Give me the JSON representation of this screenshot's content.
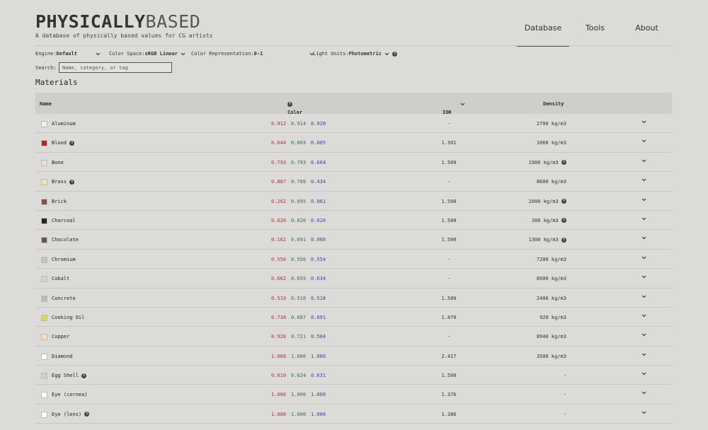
{
  "header": {
    "logo_bold": "PHYSICALLY",
    "logo_light": "BASED",
    "tagline": "A database of physically based values for CG artists"
  },
  "nav": [
    {
      "label": "Database",
      "active": true
    },
    {
      "label": "Tools",
      "active": false
    },
    {
      "label": "About",
      "active": false
    }
  ],
  "controls": {
    "engine_label": "Engine:",
    "engine_value": "Default",
    "color_space_label": "Color Space:",
    "color_space_value": "sRGB Linear",
    "color_rep_label": "Color Representation:",
    "color_rep_value": "0-1",
    "light_units_label": "Light Units:",
    "light_units_value": "Photometric"
  },
  "search": {
    "label": "Search:",
    "placeholder": "Name, category, or tag",
    "value": ""
  },
  "section_title": "Materials",
  "table": {
    "headers": {
      "name": "Name",
      "color": "Color",
      "ior": "IOR",
      "density": "Density"
    },
    "rows": [
      {
        "name": "Aluminum",
        "swatch": "#f1efed",
        "info": false,
        "r": "0.912",
        "g": "0.914",
        "b": "0.920",
        "ior": "-",
        "density": "2700 kg/m3",
        "density_info": false
      },
      {
        "name": "Blood",
        "swatch": "#d11a1e",
        "info": true,
        "r": "0.644",
        "g": "0.003",
        "b": "0.005",
        "ior": "1.301",
        "density": "1060 kg/m3",
        "density_info": false
      },
      {
        "name": "Bone",
        "swatch": "#e4e1d4",
        "info": false,
        "r": "0.793",
        "g": "0.793",
        "b": "0.664",
        "ior": "1.500",
        "density": "1900 kg/m3",
        "density_info": true
      },
      {
        "name": "Brass",
        "swatch": "#f1e3ad",
        "info": true,
        "r": "0.887",
        "g": "0.789",
        "b": "0.434",
        "ior": "-",
        "density": "8600 kg/m3",
        "density_info": false
      },
      {
        "name": "Brick",
        "swatch": "#8b5343",
        "info": false,
        "r": "0.262",
        "g": "0.095",
        "b": "0.061",
        "ior": "1.500",
        "density": "2000 kg/m3",
        "density_info": true
      },
      {
        "name": "Charcoal",
        "swatch": "#262626",
        "info": false,
        "r": "0.020",
        "g": "0.020",
        "b": "0.020",
        "ior": "1.500",
        "density": "300 kg/m3",
        "density_info": true
      },
      {
        "name": "Chocolate",
        "swatch": "#6e5546",
        "info": false,
        "r": "0.162",
        "g": "0.091",
        "b": "0.060",
        "ior": "1.500",
        "density": "1300 kg/m3",
        "density_info": true
      },
      {
        "name": "Chromium",
        "swatch": "#c4c3c2",
        "info": false,
        "r": "0.550",
        "g": "0.556",
        "b": "0.554",
        "ior": "-",
        "density": "7200 kg/m3",
        "density_info": false
      },
      {
        "name": "Cobalt",
        "swatch": "#d4d2cf",
        "info": false,
        "r": "0.662",
        "g": "0.655",
        "b": "0.634",
        "ior": "-",
        "density": "8900 kg/m3",
        "density_info": false
      },
      {
        "name": "Concrete",
        "swatch": "#bcbab6",
        "info": false,
        "r": "0.510",
        "g": "0.510",
        "b": "0.518",
        "ior": "1.500",
        "density": "2400 kg/m3",
        "density_info": false
      },
      {
        "name": "Cooking Oil",
        "swatch": "#ddd94a",
        "info": false,
        "r": "0.738",
        "g": "0.687",
        "b": "0.091",
        "ior": "1.470",
        "density": "920 kg/m3",
        "density_info": false
      },
      {
        "name": "Copper",
        "swatch": "#f3dcc0",
        "info": false,
        "r": "0.926",
        "g": "0.721",
        "b": "0.504",
        "ior": "-",
        "density": "8940 kg/m3",
        "density_info": false
      },
      {
        "name": "Diamond",
        "swatch": "#ffffff",
        "info": false,
        "r": "1.000",
        "g": "1.000",
        "b": "1.000",
        "ior": "2.417",
        "density": "3500 kg/m3",
        "density_info": false
      },
      {
        "name": "Egg Shell",
        "swatch": "#d0d0cf",
        "info": true,
        "r": "0.610",
        "g": "0.624",
        "b": "0.631",
        "ior": "1.500",
        "density": "-",
        "density_info": false
      },
      {
        "name": "Eye (cornea)",
        "swatch": "#ffffff",
        "info": false,
        "r": "1.000",
        "g": "1.000",
        "b": "1.000",
        "ior": "1.376",
        "density": "-",
        "density_info": false
      },
      {
        "name": "Eye (lens)",
        "swatch": "#ffffff",
        "info": true,
        "r": "1.000",
        "g": "1.000",
        "b": "1.000",
        "ior": "1.386",
        "density": "-",
        "density_info": false
      }
    ]
  }
}
